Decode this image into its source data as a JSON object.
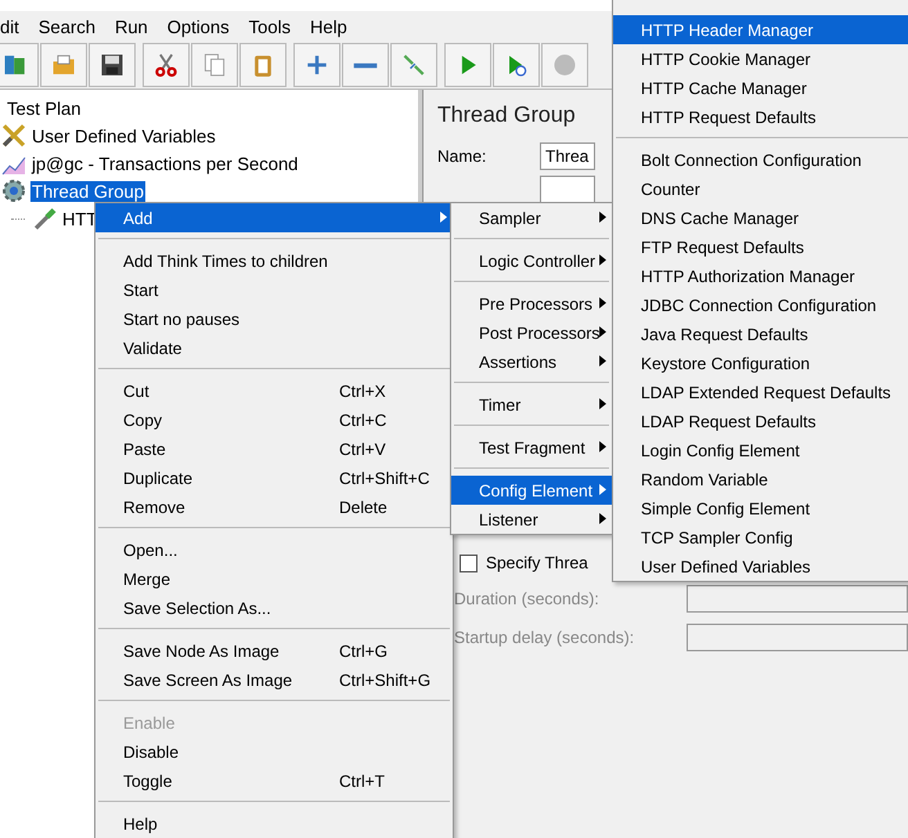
{
  "menu_bar": [
    "dit",
    "Search",
    "Run",
    "Options",
    "Tools",
    "Help"
  ],
  "tree": {
    "label": "Test Plan",
    "selected": false,
    "children": [
      {
        "label": "User Defined Variables",
        "kind": "wrench",
        "selected": false
      },
      {
        "label": "jp@gc - Transactions per Second",
        "kind": "chart",
        "selected": false
      },
      {
        "label": "Thread Group",
        "kind": "gear",
        "selected": true,
        "children": [
          {
            "label": "HTT",
            "kind": "pipette",
            "selected": false
          }
        ]
      }
    ]
  },
  "panel": {
    "title": "Thread Group",
    "name_label": "Name:",
    "name_value": "Threa",
    "specify_checkbox": {
      "label": "Specify Threa",
      "checked": false
    },
    "fields": [
      {
        "label": "Duration (seconds):",
        "disabled": true
      },
      {
        "label": "Startup delay (seconds):",
        "disabled": true
      }
    ]
  },
  "context_menu": [
    {
      "kind": "item",
      "label": "Add",
      "submenu": true,
      "selected": true,
      "disabled": false
    },
    {
      "kind": "separator"
    },
    {
      "kind": "item",
      "label": "Add Think Times to children",
      "selected": false,
      "disabled": false
    },
    {
      "kind": "item",
      "label": "Start",
      "selected": false,
      "disabled": false
    },
    {
      "kind": "item",
      "label": "Start no pauses",
      "selected": false,
      "disabled": false
    },
    {
      "kind": "item",
      "label": "Validate",
      "selected": false,
      "disabled": false
    },
    {
      "kind": "separator"
    },
    {
      "kind": "item",
      "label": "Cut",
      "shortcut": "Ctrl+X",
      "selected": false,
      "disabled": false
    },
    {
      "kind": "item",
      "label": "Copy",
      "shortcut": "Ctrl+C",
      "selected": false,
      "disabled": false
    },
    {
      "kind": "item",
      "label": "Paste",
      "shortcut": "Ctrl+V",
      "selected": false,
      "disabled": false
    },
    {
      "kind": "item",
      "label": "Duplicate",
      "shortcut": "Ctrl+Shift+C",
      "selected": false,
      "disabled": false
    },
    {
      "kind": "item",
      "label": "Remove",
      "shortcut": "Delete",
      "selected": false,
      "disabled": false
    },
    {
      "kind": "separator"
    },
    {
      "kind": "item",
      "label": "Open...",
      "selected": false,
      "disabled": false
    },
    {
      "kind": "item",
      "label": "Merge",
      "selected": false,
      "disabled": false
    },
    {
      "kind": "item",
      "label": "Save Selection As...",
      "selected": false,
      "disabled": false
    },
    {
      "kind": "separator"
    },
    {
      "kind": "item",
      "label": "Save Node As Image",
      "shortcut": "Ctrl+G",
      "selected": false,
      "disabled": false
    },
    {
      "kind": "item",
      "label": "Save Screen As Image",
      "shortcut": "Ctrl+Shift+G",
      "selected": false,
      "disabled": false
    },
    {
      "kind": "separator"
    },
    {
      "kind": "item",
      "label": "Enable",
      "selected": false,
      "disabled": true
    },
    {
      "kind": "item",
      "label": "Disable",
      "selected": false,
      "disabled": false
    },
    {
      "kind": "item",
      "label": "Toggle",
      "shortcut": "Ctrl+T",
      "selected": false,
      "disabled": false
    },
    {
      "kind": "separator"
    },
    {
      "kind": "item",
      "label": "Help",
      "selected": false,
      "disabled": false
    }
  ],
  "add_submenu": [
    {
      "kind": "item",
      "label": "Sampler",
      "submenu": true,
      "selected": false
    },
    {
      "kind": "separator"
    },
    {
      "kind": "item",
      "label": "Logic Controller",
      "submenu": true,
      "selected": false
    },
    {
      "kind": "separator"
    },
    {
      "kind": "item",
      "label": "Pre Processors",
      "submenu": true,
      "selected": false
    },
    {
      "kind": "item",
      "label": "Post Processors",
      "submenu": true,
      "selected": false
    },
    {
      "kind": "item",
      "label": "Assertions",
      "submenu": true,
      "selected": false
    },
    {
      "kind": "separator"
    },
    {
      "kind": "item",
      "label": "Timer",
      "submenu": true,
      "selected": false
    },
    {
      "kind": "separator"
    },
    {
      "kind": "item",
      "label": "Test Fragment",
      "submenu": true,
      "selected": false
    },
    {
      "kind": "separator"
    },
    {
      "kind": "item",
      "label": "Config Element",
      "submenu": true,
      "selected": true
    },
    {
      "kind": "item",
      "label": "Listener",
      "submenu": true,
      "selected": false
    }
  ],
  "config_submenu": [
    {
      "kind": "item",
      "label": "HTTP Header Manager",
      "selected": true
    },
    {
      "kind": "item",
      "label": "HTTP Cookie Manager",
      "selected": false
    },
    {
      "kind": "item",
      "label": "HTTP Cache Manager",
      "selected": false
    },
    {
      "kind": "item",
      "label": "HTTP Request Defaults",
      "selected": false
    },
    {
      "kind": "separator"
    },
    {
      "kind": "item",
      "label": "Bolt Connection Configuration",
      "selected": false
    },
    {
      "kind": "item",
      "label": "Counter",
      "selected": false
    },
    {
      "kind": "item",
      "label": "DNS Cache Manager",
      "selected": false
    },
    {
      "kind": "item",
      "label": "FTP Request Defaults",
      "selected": false
    },
    {
      "kind": "item",
      "label": "HTTP Authorization Manager",
      "selected": false
    },
    {
      "kind": "item",
      "label": "JDBC Connection Configuration",
      "selected": false
    },
    {
      "kind": "item",
      "label": "Java Request Defaults",
      "selected": false
    },
    {
      "kind": "item",
      "label": "Keystore Configuration",
      "selected": false
    },
    {
      "kind": "item",
      "label": "LDAP Extended Request Defaults",
      "selected": false
    },
    {
      "kind": "item",
      "label": "LDAP Request Defaults",
      "selected": false
    },
    {
      "kind": "item",
      "label": "Login Config Element",
      "selected": false
    },
    {
      "kind": "item",
      "label": "Random Variable",
      "selected": false
    },
    {
      "kind": "item",
      "label": "Simple Config Element",
      "selected": false
    },
    {
      "kind": "item",
      "label": "TCP Sampler Config",
      "selected": false
    },
    {
      "kind": "item",
      "label": "User Defined Variables",
      "selected": false
    }
  ]
}
